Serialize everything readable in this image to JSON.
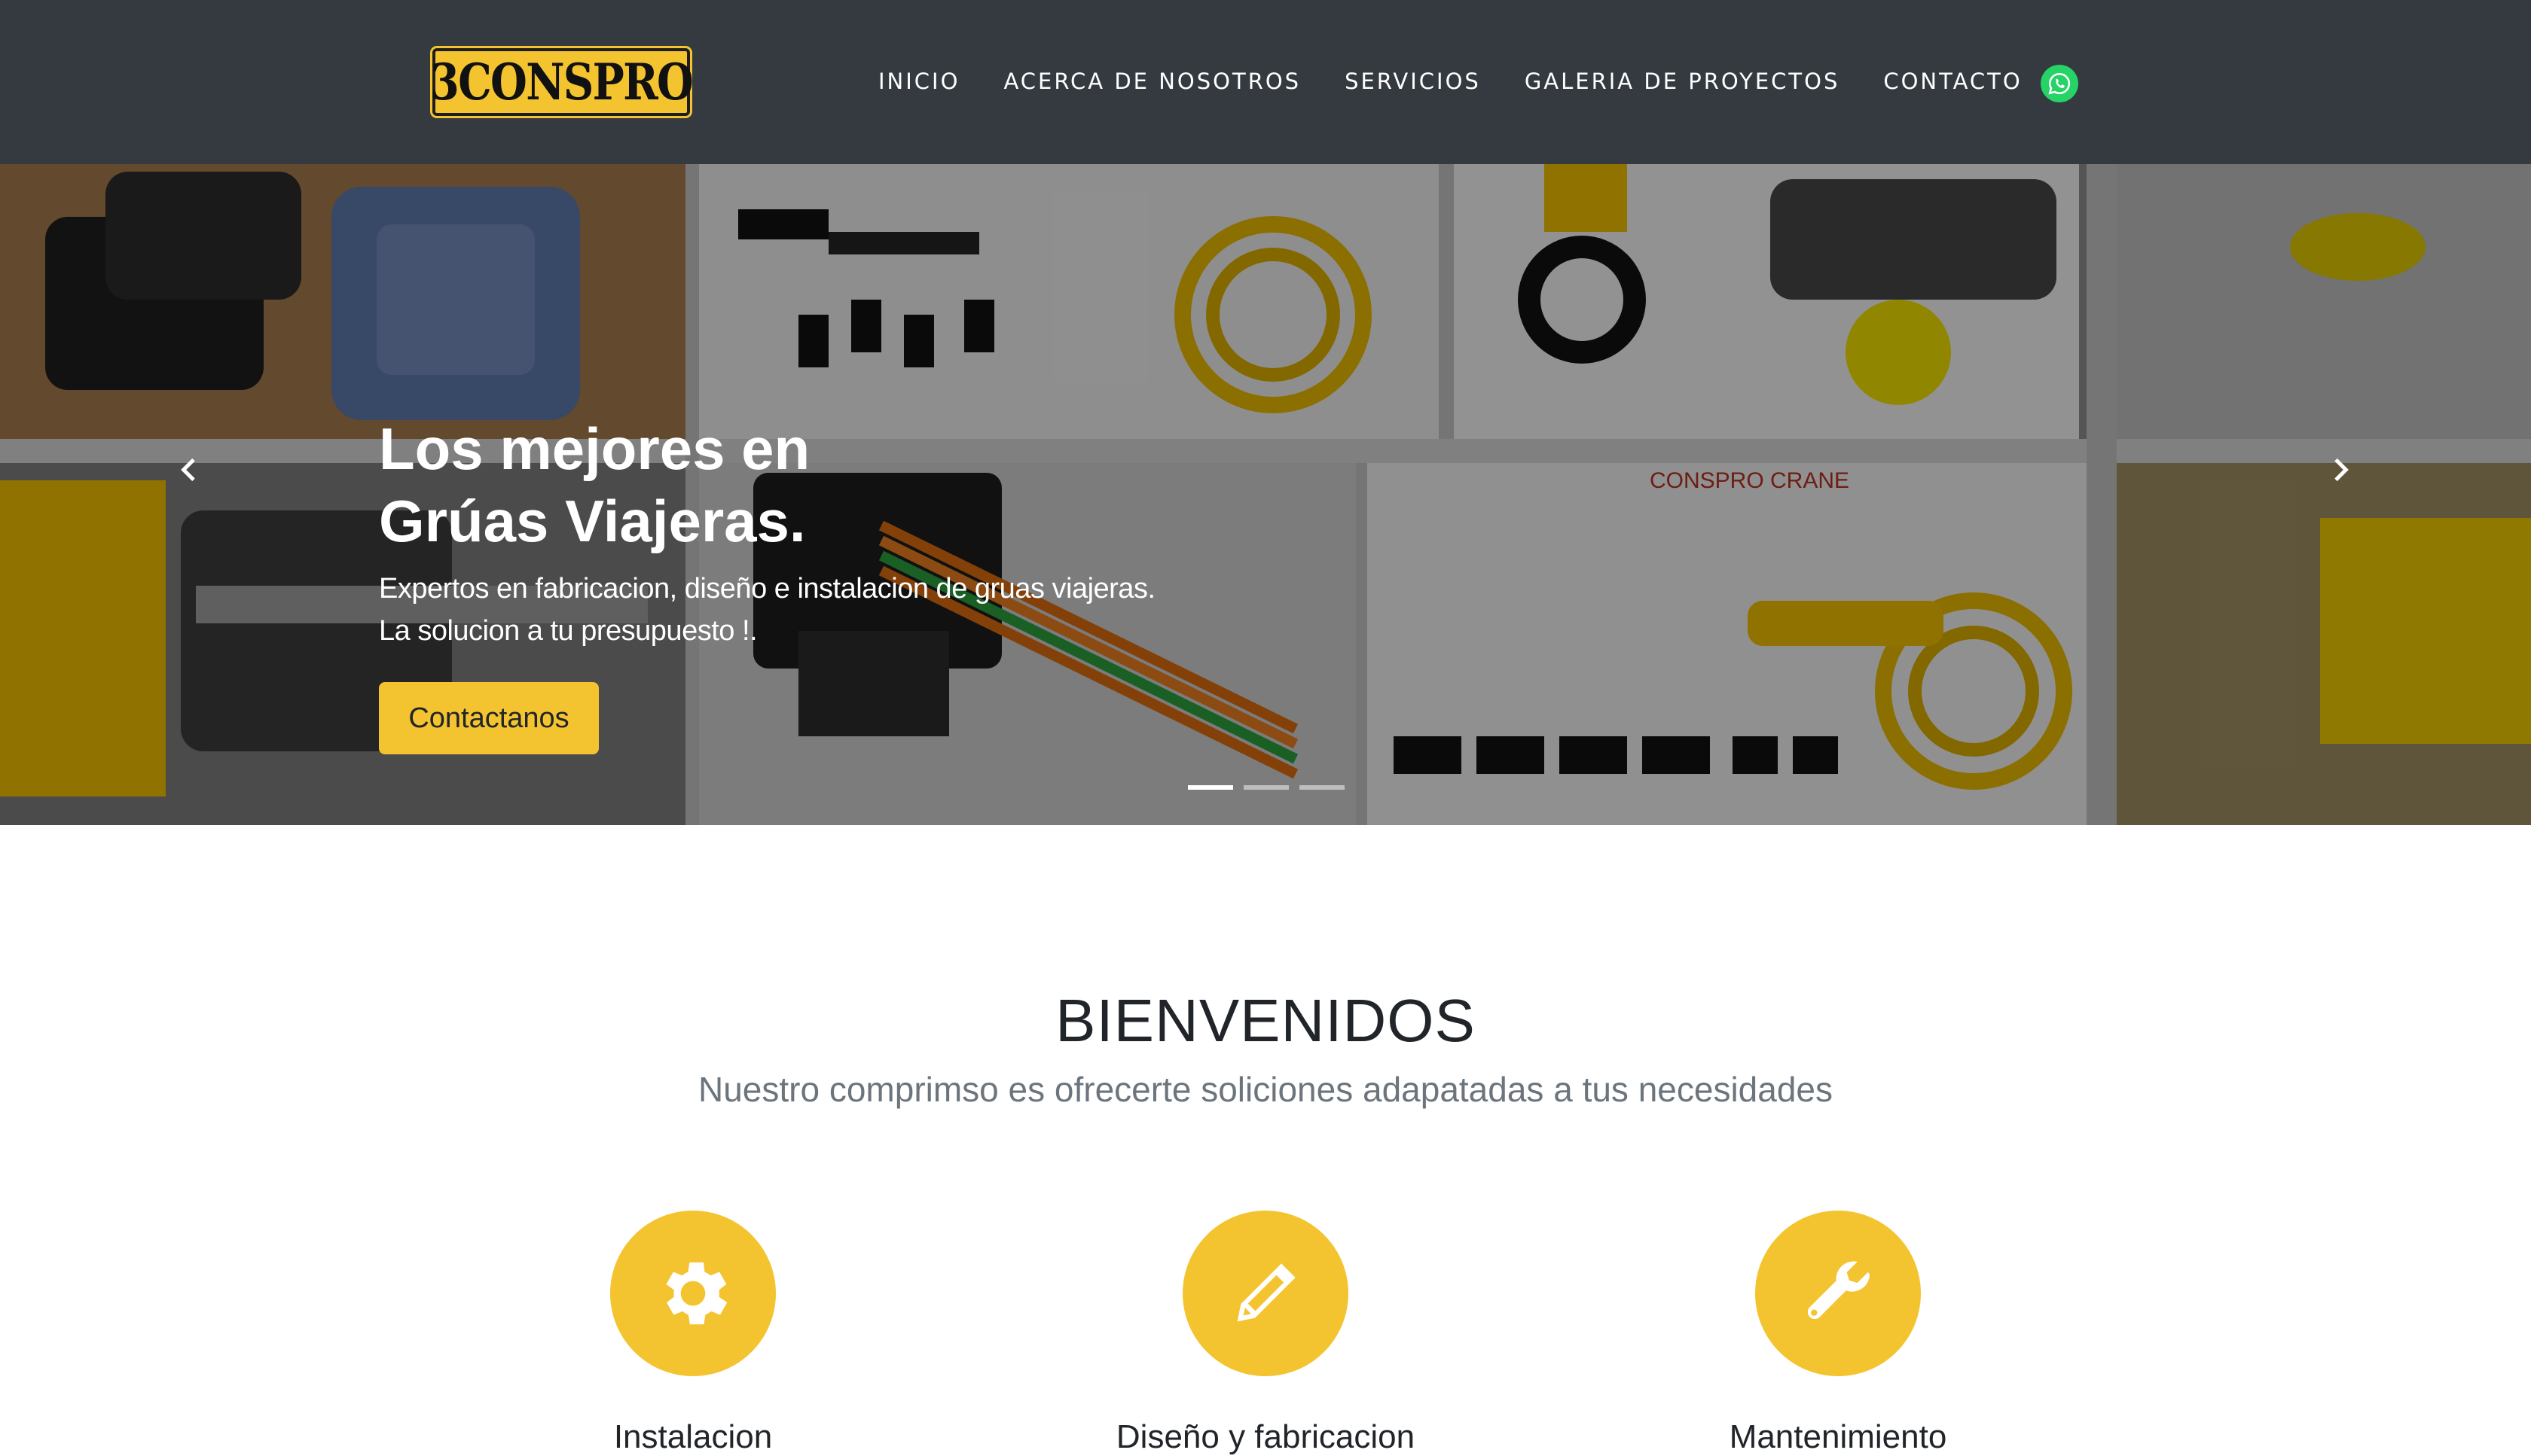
{
  "brand": {
    "logo_text": "3CONSPRO"
  },
  "nav": {
    "items": [
      {
        "label": "INICIO"
      },
      {
        "label": "ACERCA DE NOSOTROS"
      },
      {
        "label": "SERVICIOS"
      },
      {
        "label": "GALERIA DE PROYECTOS"
      },
      {
        "label": "CONTACTO"
      }
    ],
    "whatsapp_icon": "whatsapp-icon"
  },
  "hero": {
    "title_line1": "Los mejores en",
    "title_line2": "Grúas Viajeras.",
    "subtitle_line1": "Expertos en fabricacion, diseño e instalacion de gruas viajeras.",
    "subtitle_line2": "La solucion a tu presupuesto !.",
    "cta_label": "Contactanos",
    "prev_icon": "chevron-left-icon",
    "next_icon": "chevron-right-icon",
    "slides_count": 3,
    "active_slide": 1,
    "background_label": "CONSPRO CRANE"
  },
  "welcome": {
    "title": "BIENVENIDOS",
    "subtitle": "Nuestro comprimso es ofrecerte soliciones adapatadas a tus necesidades"
  },
  "features": [
    {
      "title": "Instalacion",
      "icon": "gear-icon"
    },
    {
      "title": "Diseño y fabricacion",
      "icon": "pencil-icon"
    },
    {
      "title": "Mantenimiento",
      "icon": "wrench-icon"
    }
  ],
  "colors": {
    "navbar_bg": "#343a40",
    "accent": "#f4c430",
    "whatsapp": "#25d366",
    "muted_text": "#6c757d"
  }
}
